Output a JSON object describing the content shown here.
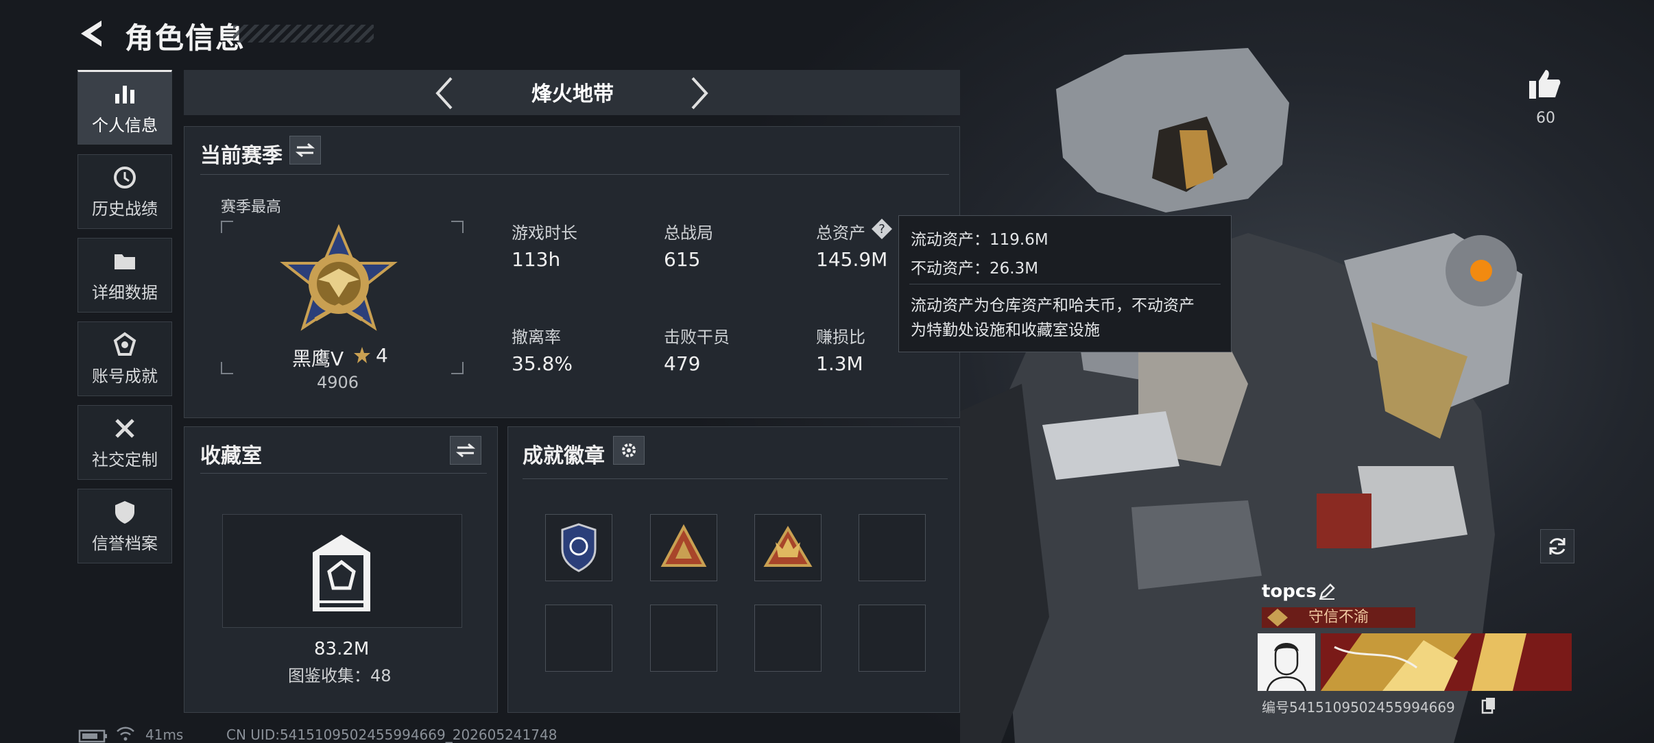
{
  "header": {
    "title": "角色信息"
  },
  "nav": [
    {
      "label": "个人信息",
      "icon": "bar-chart-icon",
      "active": true
    },
    {
      "label": "历史战绩",
      "icon": "history-icon"
    },
    {
      "label": "详细数据",
      "icon": "folder-icon"
    },
    {
      "label": "账号成就",
      "icon": "achievement-icon"
    },
    {
      "label": "社交定制",
      "icon": "tools-icon"
    },
    {
      "label": "信誉档案",
      "icon": "shield-icon"
    }
  ],
  "mode": {
    "label": "烽火地带"
  },
  "season": {
    "title": "当前赛季",
    "highest_label": "赛季最高",
    "rank_name": "黑鹰V",
    "rank_stars": "4",
    "rank_points": "4906",
    "stats": [
      {
        "label": "游戏时长",
        "value": "113h"
      },
      {
        "label": "总战局",
        "value": "615"
      },
      {
        "label": "总资产",
        "value": "145.9M"
      },
      {
        "label": "撤离率",
        "value": "35.8%"
      },
      {
        "label": "击败干员",
        "value": "479"
      },
      {
        "label": "赚损比",
        "value": "1.3M"
      }
    ]
  },
  "tooltip": {
    "line1": "流动资产：119.6M",
    "line2": "不动资产：26.3M",
    "desc1": "流动资产为仓库资产和哈夫币，不动资产",
    "desc2": "为特勤处设施和收藏室设施"
  },
  "collection": {
    "title": "收藏室",
    "value": "83.2M",
    "catalog": "图鉴收集：48"
  },
  "badges": {
    "title": "成就徽章"
  },
  "profile": {
    "name": "topcs",
    "honor": "守信不渝",
    "uid_label": "编号",
    "uid": "5415109502455994669",
    "likes": "60"
  },
  "status": {
    "ping": "41ms",
    "cn_uid": "CN UID:5415109502455994669_202605241748"
  },
  "colors": {
    "accent_gold": "#c9a052",
    "honor_red": "#6b1d18",
    "panel": "#23282f"
  }
}
